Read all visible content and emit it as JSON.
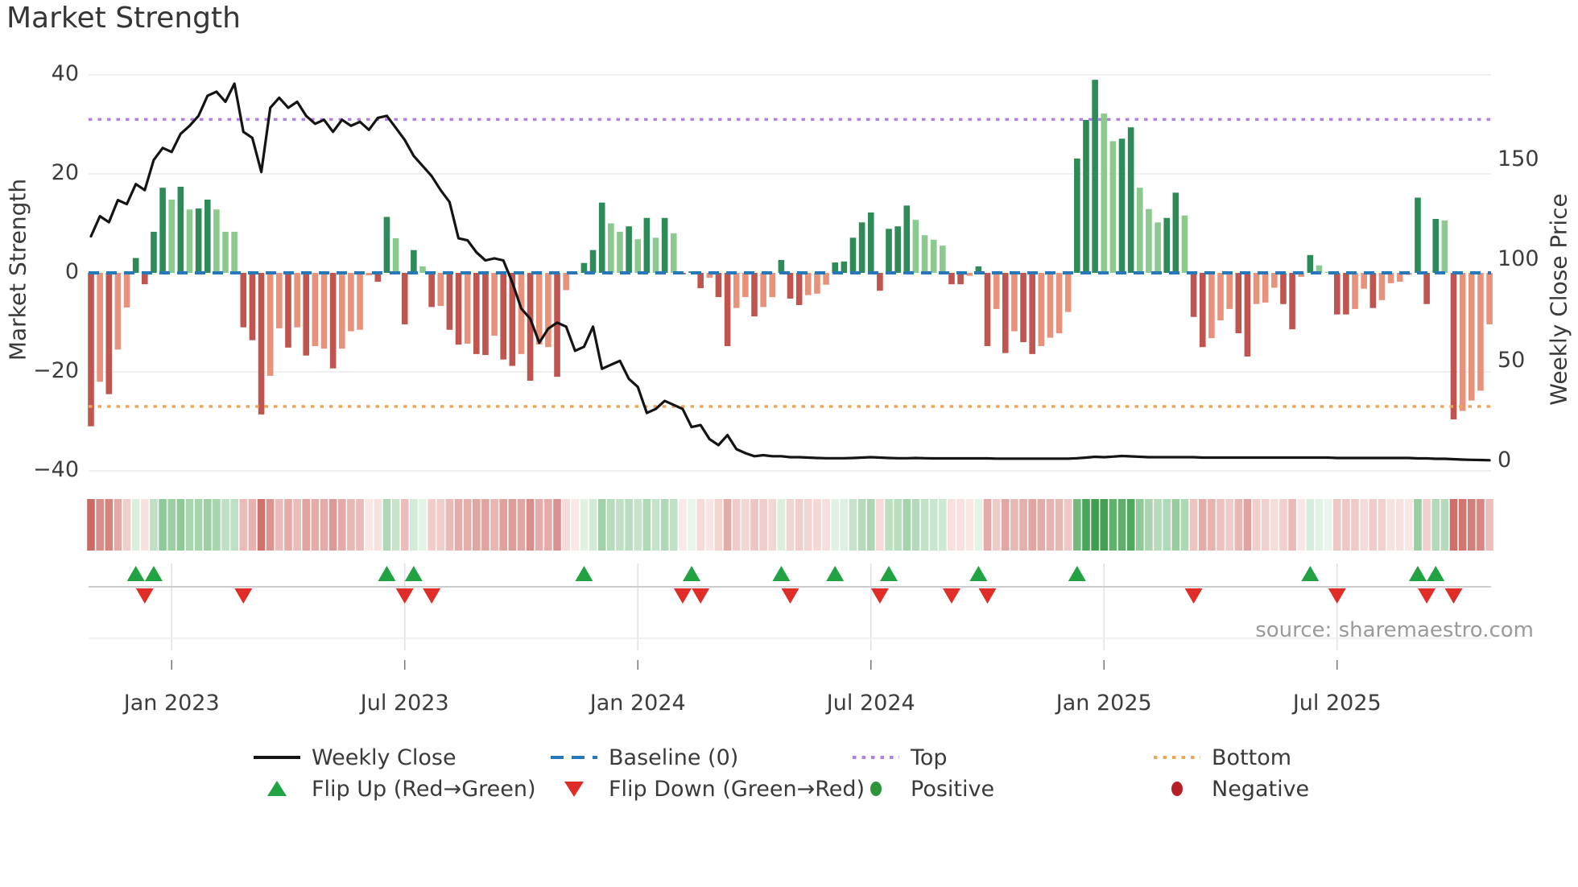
{
  "title": "Market Strength",
  "source": "source: sharemaestro.com",
  "axes": {
    "left": {
      "label": "Market Strength",
      "tick_labels": [
        "40",
        "20",
        "0",
        "−20",
        "−40"
      ]
    },
    "right": {
      "label": "Weekly Close Price",
      "tick_labels": [
        "150",
        "100",
        "50",
        "0"
      ]
    },
    "x": {
      "tick_labels": [
        "Jan 2023",
        "Jul 2023",
        "Jan 2024",
        "Jul 2024",
        "Jan 2025",
        "Jul 2025"
      ]
    }
  },
  "legend": {
    "items": [
      {
        "label": "Weekly Close",
        "type": "line",
        "color": "#141414"
      },
      {
        "label": "Baseline (0)",
        "type": "dashed",
        "color": "#2878b8"
      },
      {
        "label": "Top",
        "type": "dotted",
        "color": "#b180e0"
      },
      {
        "label": "Bottom",
        "type": "dotted",
        "color": "#f0a657"
      },
      {
        "label": "Flip Up (Red→Green)",
        "type": "triangle-up",
        "color": "#21a344"
      },
      {
        "label": "Flip Down (Green→Red)",
        "type": "triangle-down",
        "color": "#e02d28"
      },
      {
        "label": "Positive",
        "type": "circle",
        "color": "#2d9437"
      },
      {
        "label": "Negative",
        "type": "circle",
        "color": "#b42025"
      }
    ]
  },
  "colors": {
    "bar_positive_dark": "#2e8b57",
    "bar_positive_light": "#8cc98f",
    "bar_negative_dark": "#c0544f",
    "bar_negative_light": "#e8927c",
    "baseline": "#2878b8",
    "top_line": "#b180e0",
    "bottom_line": "#f0a657",
    "price_line": "#141414",
    "flip_up": "#21a344",
    "flip_down": "#e02d28",
    "grid": "#e8e8ef",
    "band_grid": "#e0e0e6",
    "marker_axis": "#cccccc",
    "text": "#3a3a3a",
    "muted_text": "#9a9a9a"
  },
  "chart_data": {
    "type": "bar+line",
    "title": "Market Strength",
    "frequency": "weekly",
    "weeks": 157,
    "ylabel_left": "Market Strength",
    "ylabel_right": "Weekly Close Price",
    "ylim_left": [
      -40,
      40
    ],
    "yticks_left": [
      40,
      20,
      0,
      -20,
      -40
    ],
    "yticks_right": [
      150,
      100,
      50,
      0
    ],
    "ylim_right": [
      -5,
      195
    ],
    "grid": true,
    "legend_position": "bottom",
    "baseline": 0,
    "top_threshold": 31,
    "bottom_threshold": -27,
    "x_tick_labels": [
      "Jan 2023",
      "Jul 2023",
      "Jan 2024",
      "Jul 2024",
      "Jan 2025",
      "Jul 2025"
    ],
    "x_tick_week_index": [
      9,
      35,
      61,
      87,
      113,
      139
    ],
    "strength": [
      -31,
      -22,
      -24.5,
      -15.5,
      -7,
      3,
      -2.3,
      8.3,
      17.2,
      14.8,
      17.4,
      12.8,
      13,
      14.8,
      12.8,
      8.3,
      8.3,
      -11,
      -13.6,
      -28.6,
      -20.8,
      -11.2,
      -15.1,
      -11,
      -16.7,
      -14.8,
      -15.3,
      -19.3,
      -15.3,
      -11.8,
      -11.5,
      -0.5,
      -1.8,
      11.3,
      7,
      -10.4,
      4.6,
      1.3,
      -6.9,
      -6.7,
      -11.5,
      -14.5,
      -14.3,
      -16.4,
      -16.6,
      -12.7,
      -17.5,
      -18.8,
      -16.4,
      -21.8,
      -14.5,
      -15,
      -21,
      -3.5,
      -0.3,
      2,
      4.6,
      14.2,
      10,
      8.3,
      9.4,
      6.8,
      11.1,
      7.1,
      11.1,
      8,
      -0.3,
      0.3,
      -3.1,
      -1,
      -4.9,
      -14.8,
      -7.1,
      -4.9,
      -8.8,
      -6.9,
      -4.9,
      2.6,
      -5.2,
      -6.5,
      -4.5,
      -4.2,
      -2.4,
      2.1,
      2.3,
      7.1,
      10.2,
      12.2,
      -3.6,
      8.9,
      9.4,
      13.6,
      10.7,
      7.6,
      6.7,
      5.5,
      -2.3,
      -2.3,
      -0.6,
      1.3,
      -14.8,
      -7.3,
      -16.2,
      -11.8,
      -14,
      -16.4,
      -14.8,
      -13.1,
      -12.2,
      -7.9,
      23.1,
      30.9,
      39,
      32.2,
      26.6,
      27.1,
      29.4,
      17.2,
      12.9,
      10.2,
      11.1,
      16.2,
      11.6,
      -8.9,
      -15,
      -13.2,
      -9.6,
      -7.3,
      -12.2,
      -16.9,
      -6.3,
      -6,
      -3,
      -6.3,
      -11.4,
      -0.8,
      3.6,
      1.5,
      0.2,
      -8.4,
      -8.4,
      -7.3,
      -3.2,
      -7.1,
      -5.5,
      -2.1,
      -1.8,
      -0.4,
      15.2,
      -6.3,
      10.9,
      10.6,
      -29.6,
      -27.9,
      -25.8,
      -23.8,
      -10.4
    ],
    "shade_dark": [
      1,
      0,
      1,
      0,
      0,
      1,
      1,
      1,
      1,
      0,
      1,
      0,
      1,
      1,
      0,
      0,
      0,
      1,
      1,
      1,
      0,
      0,
      1,
      0,
      1,
      0,
      0,
      1,
      0,
      0,
      0,
      0,
      1,
      1,
      0,
      1,
      1,
      0,
      1,
      0,
      1,
      1,
      0,
      1,
      1,
      0,
      1,
      1,
      0,
      1,
      0,
      0,
      1,
      0,
      0,
      1,
      1,
      1,
      0,
      0,
      1,
      0,
      1,
      0,
      1,
      0,
      1,
      1,
      1,
      0,
      1,
      1,
      0,
      0,
      1,
      0,
      0,
      1,
      1,
      1,
      0,
      0,
      0,
      1,
      1,
      1,
      1,
      1,
      1,
      1,
      1,
      1,
      0,
      0,
      0,
      0,
      1,
      1,
      0,
      1,
      1,
      0,
      1,
      0,
      1,
      1,
      0,
      0,
      0,
      0,
      1,
      1,
      1,
      0,
      0,
      1,
      1,
      0,
      0,
      0,
      1,
      1,
      0,
      1,
      1,
      0,
      0,
      0,
      1,
      1,
      0,
      0,
      0,
      1,
      1,
      0,
      1,
      0,
      0,
      1,
      1,
      0,
      0,
      1,
      0,
      0,
      0,
      0,
      1,
      1,
      1,
      0,
      1,
      0,
      0,
      0,
      0
    ],
    "price": [
      112,
      122,
      119,
      130,
      128,
      138,
      135,
      150,
      156,
      154,
      163,
      167,
      172,
      182,
      184,
      179,
      188,
      164,
      161,
      144,
      176,
      181,
      176,
      179,
      172,
      168,
      170,
      164,
      170,
      167,
      169,
      165,
      171,
      172,
      166,
      160,
      152,
      147,
      142,
      135,
      129,
      111,
      110,
      104,
      100,
      101,
      100,
      89,
      76,
      71,
      59,
      66,
      69,
      67,
      55,
      57,
      67,
      46,
      48,
      50,
      41,
      37,
      24,
      26,
      30,
      28,
      26,
      17,
      18,
      11,
      8,
      13,
      6,
      4,
      2.5,
      3,
      2.5,
      2.5,
      2,
      2,
      1.8,
      1.6,
      1.5,
      1.5,
      1.5,
      1.6,
      1.8,
      2,
      1.8,
      1.6,
      1.5,
      1.5,
      1.6,
      1.5,
      1.4,
      1.4,
      1.4,
      1.4,
      1.4,
      1.4,
      1.4,
      1.3,
      1.3,
      1.3,
      1.3,
      1.3,
      1.3,
      1.3,
      1.3,
      1.3,
      1.5,
      1.8,
      2.2,
      2,
      2.3,
      2.6,
      2.4,
      2.2,
      2,
      2,
      2,
      2,
      2,
      2,
      1.8,
      1.8,
      1.8,
      1.8,
      1.8,
      1.8,
      1.8,
      1.8,
      1.8,
      1.8,
      1.8,
      1.8,
      1.8,
      1.8,
      1.8,
      1.6,
      1.6,
      1.6,
      1.6,
      1.6,
      1.6,
      1.6,
      1.6,
      1.6,
      1.4,
      1.4,
      1.2,
      1.2,
      1,
      0.8,
      0.7,
      0.6,
      0.5
    ]
  }
}
